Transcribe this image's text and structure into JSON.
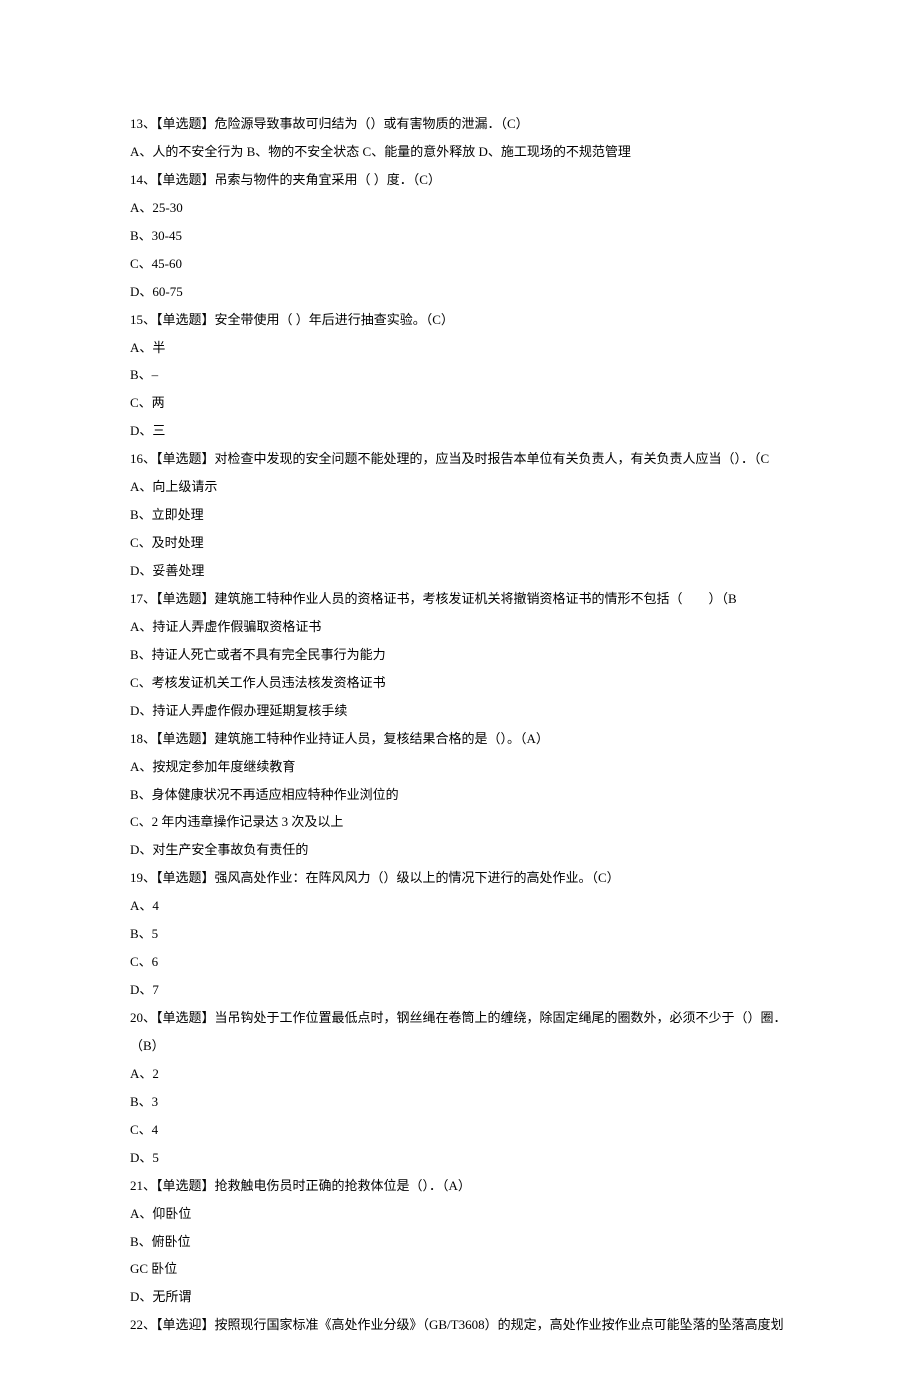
{
  "lines": [
    "13、【单选题】危险源导致事故可归结为（）或有害物质的泄漏．（C）",
    "A、人的不安全行为 B、物的不安全状态 C、能量的意外释放 D、施工现场的不规范管理",
    "14、【单选题】吊索与物件的夹角宜采用（ ）度．（C）",
    "A、25-30",
    "B、30-45",
    "C、45-60",
    "D、60-75",
    "15、【单选题】安全带使用（ ）年后进行抽查实验。（C）",
    "A、半",
    "B、–",
    "C、两",
    "D、三",
    "16、【单选题】对检查中发现的安全问题不能处理的，应当及时报告本单位有关负责人，有关负责人应当（）．（C",
    "A、向上级请示",
    "B、立即处理",
    "C、及时处理",
    "D、妥善处理",
    "17、【单选题】建筑施工特种作业人员的资格证书，考核发证机关将撤销资格证书的情形不包括（　　）（B",
    "A、持证人弄虚作假骗取资格证书",
    "B、持证人死亡或者不具有完全民事行为能力",
    "C、考核发证机关工作人员违法核发资格证书",
    "D、持证人弄虚作假办理延期复核手续",
    "18、【单选题】建筑施工特种作业持证人员，复核结果合格的是（）。（A）",
    "A、按规定参加年度继续教育",
    "B、身体健康状况不再适应相应特种作业浏位的",
    "C、2 年内违章操作记录达 3 次及以上",
    "D、对生产安全事故负有责任的",
    "19、【单选题】强风高处作业：在阵风风力（）级以上的情况下进行的高处作业。（C）",
    "A、4",
    "B、5",
    "C、6",
    "D、7",
    "20、【单选题】当吊钩处于工作位置最低点时，钢丝绳在卷筒上的缠绕，除固定绳尾的圈数外，必须不少于（）圈．（B）",
    "A、2",
    "B、3",
    "C、4",
    "D、5",
    "21、【单选题】抢救触电伤员时正确的抢救体位是（）．（A）",
    "A、仰卧位",
    "B、俯卧位",
    "GC 卧位",
    "D、无所谓",
    "22、【单选迎】按照现行国家标准《高处作业分级》（GB/T3608）的规定，高处作业按作业点可能坠落的坠落高度划"
  ]
}
